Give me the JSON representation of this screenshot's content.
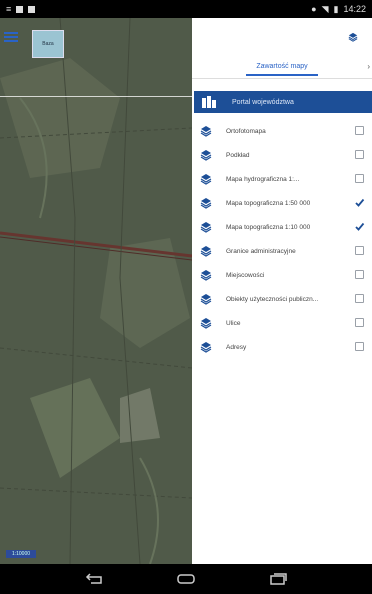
{
  "status_bar": {
    "time": "14:22"
  },
  "map": {
    "thumbnail_label": "Baza",
    "scale_label": "1:10000"
  },
  "panel": {
    "tab": "Zawartość mapy",
    "portal_label": "Portal województwa",
    "layers": [
      {
        "label": "Ortofotomapa",
        "checked": false
      },
      {
        "label": "Podkład",
        "checked": false
      },
      {
        "label": "Mapa hydrograficzna 1:...",
        "checked": false
      },
      {
        "label": "Mapa topograficzna 1:50 000",
        "checked": true
      },
      {
        "label": "Mapa topograficzna 1:10 000",
        "checked": true
      },
      {
        "label": "Granice administracyjne",
        "checked": false
      },
      {
        "label": "Miejscowości",
        "checked": false
      },
      {
        "label": "Obiekty użyteczności publiczn...",
        "checked": false
      },
      {
        "label": "Ulice",
        "checked": false
      },
      {
        "label": "Adresy",
        "checked": false
      }
    ]
  },
  "colors": {
    "accent": "#2a63c6",
    "portal_bg": "#1d4f97"
  }
}
